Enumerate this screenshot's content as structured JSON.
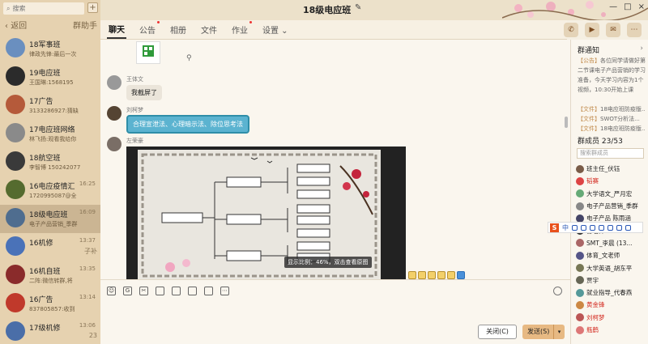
{
  "search_placeholder": "搜索",
  "add_icon": "+",
  "nav": {
    "back": "返回",
    "assistant": "群助手"
  },
  "chats": [
    {
      "name": "18军事班",
      "msg": "律政先锋:最后一次",
      "time": "",
      "badge": ""
    },
    {
      "name": "19电应班",
      "msg": "王国琳:1568195",
      "time": "",
      "badge": ""
    },
    {
      "name": "17广告",
      "msg": "3133286927:猜缺",
      "time": "",
      "badge": ""
    },
    {
      "name": "17电应班网络",
      "msg": "林飞扬:观看我给你",
      "time": "",
      "badge": ""
    },
    {
      "name": "18航空班",
      "msg": "李智博 150242077",
      "time": "",
      "badge": ""
    },
    {
      "name": "16电应疫情汇",
      "msg": "1720995087@全",
      "time": "16:25",
      "badge": ""
    },
    {
      "name": "18级电应班",
      "msg": "电子产品营销_季群",
      "time": "16:09",
      "badge": ""
    },
    {
      "name": "16机修",
      "msg": "",
      "time": "13:37",
      "badge": "子补"
    },
    {
      "name": "16机自班",
      "msg": "二阵:微信转群,将",
      "time": "13:35",
      "badge": ""
    },
    {
      "name": "16广告",
      "msg": "837805857:收到",
      "time": "13:14",
      "badge": ""
    },
    {
      "name": "17级机修",
      "msg": "",
      "time": "13:06",
      "badge": "23"
    }
  ],
  "header": {
    "title": "18级电应班",
    "edit_icon": "pencil-icon",
    "win_buttons": [
      "—",
      "□",
      "×"
    ]
  },
  "tabs": [
    {
      "label": "聊天",
      "active": true,
      "dot": false
    },
    {
      "label": "公告",
      "active": false,
      "dot": true
    },
    {
      "label": "相册",
      "active": false,
      "dot": false
    },
    {
      "label": "文件",
      "active": false,
      "dot": false
    },
    {
      "label": "作业",
      "active": false,
      "dot": true
    },
    {
      "label": "设置 ⌄",
      "active": false,
      "dot": false
    }
  ],
  "messages": [
    {
      "sender": "王体文",
      "text": "我截屏了"
    },
    {
      "sender": "刘柯梦",
      "text": "合理宣泄法、心理暗示法、除位思考法"
    },
    {
      "sender": "左荣豪",
      "text": ""
    }
  ],
  "image_zoom_tip": "显示比例：46%，双击查看原图",
  "buttons": {
    "close": "关闭(C)",
    "send": "发送(S)"
  },
  "notice": {
    "title": "群通知",
    "items": [
      {
        "tag": "【公告】",
        "text": "各位同学请做好第二节课电子产品营销的学习准备，今天学习内容为1个视频，10:30开始上课"
      },
      {
        "tag": "【文件】",
        "text": "18电应班防疫版..."
      },
      {
        "tag": "【文件】",
        "text": "SWOT分析法..."
      },
      {
        "tag": "【文件】",
        "text": "18电应班防疫版..."
      }
    ]
  },
  "members": {
    "title": "群成员 23/53",
    "search_placeholder": "搜索群成员",
    "list": [
      {
        "name": "班主任_伏钰",
        "color": "#222"
      },
      {
        "name": "韬赛",
        "color": "#d3281e"
      },
      {
        "name": "大学语文_严月宏",
        "color": "#222"
      },
      {
        "name": "电子产品营销_季群",
        "color": "#222"
      },
      {
        "name": "电子产品 陈雨涵",
        "color": "#222"
      },
      {
        "name": "曹老师",
        "color": "#222"
      },
      {
        "name": "SMT_李晨 (13...",
        "color": "#222"
      },
      {
        "name": "体育_文老师",
        "color": "#222"
      },
      {
        "name": "大学英语_胡东平",
        "color": "#222"
      },
      {
        "name": "贾宇",
        "color": "#222"
      },
      {
        "name": "就业指导_代春燕",
        "color": "#222"
      },
      {
        "name": "黄金锋",
        "color": "#d3281e"
      },
      {
        "name": "刘柯梦",
        "color": "#d3281e"
      },
      {
        "name": "瓶鹤",
        "color": "#d3281e"
      }
    ]
  },
  "ime": {
    "mode": "中"
  }
}
